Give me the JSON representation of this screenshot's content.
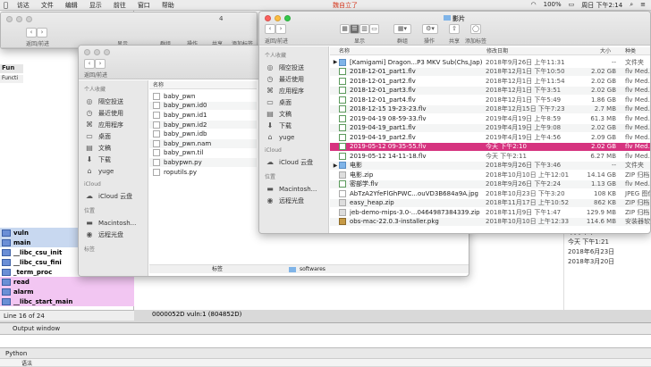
{
  "menubar": {
    "apple": "",
    "items": [
      "访达",
      "文件",
      "编辑",
      "显示",
      "前往",
      "窗口",
      "帮助"
    ],
    "center_app": "魏自立了",
    "battery": "100%",
    "clock": "周日 下午2:14"
  },
  "ida": {
    "functions_label": "Fun",
    "functions_header": "Functi",
    "rows": [
      {
        "name": "vuln",
        "style": "blue"
      },
      {
        "name": "main",
        "style": "blue"
      },
      {
        "name": "__libc_csu_init",
        "style": "plain"
      },
      {
        "name": "__libc_csu_fini",
        "style": "plain"
      },
      {
        "name": "_term_proc",
        "style": "plain"
      },
      {
        "name": "read",
        "style": "pink"
      },
      {
        "name": "alarm",
        "style": "pink"
      },
      {
        "name": "__libc_start_main",
        "style": "pink"
      }
    ],
    "status": "Line 16 of 24",
    "address": "0000052D  vuln:1 (804852D)",
    "output_title": "Output window",
    "python_tab": "Python",
    "bottom_text": "语法"
  },
  "right_strip": {
    "rows": [
      "今天 下午1:21",
      "今天 下午1:21",
      "2018年6月23日",
      "2018年3月20日"
    ]
  },
  "back_window": {
    "title": "4",
    "nav_label": "返回/前进",
    "toolbar": [
      "显示",
      "群组",
      "操作",
      "共享",
      "添加标签"
    ]
  },
  "mid_window": {
    "nav_label": "返回/前进",
    "sidebar": {
      "favorites_header": "个人收藏",
      "favorites": [
        {
          "icon": "airdrop-icon",
          "label": "隔空投送"
        },
        {
          "icon": "recents-icon",
          "label": "最近使用"
        },
        {
          "icon": "apps-icon",
          "label": "应用程序"
        },
        {
          "icon": "desktop-icon",
          "label": "桌面"
        },
        {
          "icon": "documents-icon",
          "label": "文稿"
        },
        {
          "icon": "downloads-icon",
          "label": "下载"
        },
        {
          "icon": "home-icon",
          "label": "yuge"
        }
      ],
      "icloud_header": "iCloud",
      "icloud": [
        {
          "icon": "cloud-icon",
          "label": "iCloud 云盘"
        }
      ],
      "locations_header": "位置",
      "locations": [
        {
          "icon": "disk-icon",
          "label": "Macintosh..."
        },
        {
          "icon": "disc-icon",
          "label": "远程光盘"
        }
      ],
      "tags_header": "标签"
    },
    "files_header": "名称",
    "files": [
      "baby_pwn",
      "baby_pwn.id0",
      "baby_pwn.id1",
      "baby_pwn.id2",
      "baby_pwn.idb",
      "baby_pwn.nam",
      "baby_pwn.til",
      "babypwn.py",
      "roputils.py"
    ],
    "path_row": [
      "标签",
      "softwares"
    ]
  },
  "front_window": {
    "title": "影片",
    "nav_label": "返回/前进",
    "toolbar": [
      "显示",
      "群组",
      "操作",
      "共享",
      "添加标签"
    ],
    "sidebar": {
      "favorites_header": "个人收藏",
      "favorites": [
        {
          "icon": "airdrop-icon",
          "label": "隔空投送"
        },
        {
          "icon": "recents-icon",
          "label": "最近使用"
        },
        {
          "icon": "apps-icon",
          "label": "应用程序"
        },
        {
          "icon": "desktop-icon",
          "label": "桌面"
        },
        {
          "icon": "documents-icon",
          "label": "文稿"
        },
        {
          "icon": "downloads-icon",
          "label": "下载"
        },
        {
          "icon": "home-icon",
          "label": "yuge"
        }
      ],
      "icloud_header": "iCloud",
      "icloud": [
        {
          "icon": "cloud-icon",
          "label": "iCloud 云盘"
        }
      ],
      "locations_header": "位置",
      "locations": [
        {
          "icon": "disk-icon",
          "label": "Macintosh..."
        },
        {
          "icon": "disc-icon",
          "label": "远程光盘"
        }
      ]
    },
    "columns": [
      "名称",
      "修改日期",
      "大小",
      "种类"
    ],
    "files": [
      {
        "name": "[Kamigami] Dragon...P3 MKV Sub(Chs,Jap)]",
        "date": "2018年9月26日 上午11:31",
        "size": "--",
        "kind": "文件夹",
        "type": "folder",
        "disclosure": "▶"
      },
      {
        "name": "2018-12-01_part1.flv",
        "date": "2018年12月1日 下午10:50",
        "size": "2.02 GB",
        "kind": "flv Med...",
        "type": "flv"
      },
      {
        "name": "2018-12-01_part2.flv",
        "date": "2018年12月1日 上午11:54",
        "size": "2.02 GB",
        "kind": "flv Med...",
        "type": "flv"
      },
      {
        "name": "2018-12-01_part3.flv",
        "date": "2018年12月1日 下午3:51",
        "size": "2.02 GB",
        "kind": "flv Med...",
        "type": "flv"
      },
      {
        "name": "2018-12-01_part4.flv",
        "date": "2018年12月1日 下午5:49",
        "size": "1.86 GB",
        "kind": "flv Med...",
        "type": "flv"
      },
      {
        "name": "2018-12-15 19-23-23.flv",
        "date": "2018年12月15日 下午7:23",
        "size": "2.7 MB",
        "kind": "flv Med...",
        "type": "flv"
      },
      {
        "name": "2019-04-19 08-59-33.flv",
        "date": "2019年4月19日 上午8:59",
        "size": "61.3 MB",
        "kind": "flv Med...",
        "type": "flv"
      },
      {
        "name": "2019-04-19_part1.flv",
        "date": "2019年4月19日 上午9:08",
        "size": "2.02 GB",
        "kind": "flv Med...",
        "type": "flv"
      },
      {
        "name": "2019-04-19_part2.flv",
        "date": "2019年4月19日 上午4:56",
        "size": "2.09 GB",
        "kind": "flv Med...",
        "type": "flv"
      },
      {
        "name": "2019-05-12 09-35-55.flv",
        "date": "今天 下午2:10",
        "size": "2.02 GB",
        "kind": "flv Med...",
        "type": "flv",
        "selected": true
      },
      {
        "name": "2019-05-12 14-11-18.flv",
        "date": "今天 下午2:11",
        "size": "6.27 MB",
        "kind": "flv Med...",
        "type": "flv"
      },
      {
        "name": "电影",
        "date": "2018年9月26日 下午3:46",
        "size": "--",
        "kind": "文件夹",
        "type": "folder",
        "disclosure": "▶"
      },
      {
        "name": "电影.zip",
        "date": "2018年10月10日 上午12:01",
        "size": "14.14 GB",
        "kind": "ZIP 归档",
        "type": "zip"
      },
      {
        "name": "密部学.flv",
        "date": "2018年9月26日 下午2:24",
        "size": "1.13 GB",
        "kind": "flv Med...",
        "type": "flv"
      },
      {
        "name": "AbTzA2YfeFlGhPWC...ouVD3B684a9A.jpg",
        "date": "2018年10月23日 下午3:20",
        "size": "108 KB",
        "kind": "JPEG 图像",
        "type": "jpg"
      },
      {
        "name": "easy_heap.zip",
        "date": "2018年11月17日 上午10:52",
        "size": "862 KB",
        "kind": "ZIP 归档",
        "type": "zip"
      },
      {
        "name": "jeb-demo-mips-3.0-...0464987384339.zip",
        "date": "2018年11月9日 下午1:47",
        "size": "129.9 MB",
        "kind": "ZIP 归档",
        "type": "zip"
      },
      {
        "name": "obs-mac-22.0.3-installer.pkg",
        "date": "2018年10月10日 上午12:33",
        "size": "114.6 MB",
        "kind": "安装器软件",
        "type": "pkg"
      }
    ]
  }
}
